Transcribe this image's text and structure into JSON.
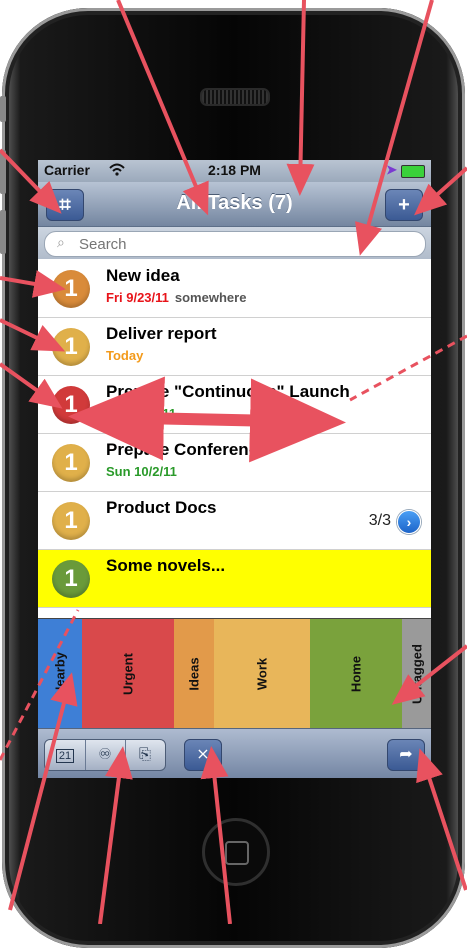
{
  "status_bar": {
    "carrier": "Carrier",
    "wifi_icon": "wifi-icon",
    "time": "2:18 PM",
    "location_icon": "location-arrow-icon",
    "battery_icon": "battery-icon"
  },
  "navbar": {
    "title": "All Tasks (7)",
    "left_icon": "gear-icon",
    "right_icon": "plus-icon",
    "right_label": "+"
  },
  "search": {
    "placeholder": "Search",
    "icon": "search-icon"
  },
  "tasks": [
    {
      "priority": "1",
      "name": "New idea",
      "date": "Fri 9/23/11",
      "date_color": "#e8141a",
      "location": "somewhere",
      "badge_color": "#d98b3a"
    },
    {
      "priority": "1",
      "name": "Deliver report",
      "date": "Today",
      "date_color": "#f39a1a",
      "location": "",
      "badge_color": "#e0b04a"
    },
    {
      "priority": "1",
      "name": "Prepare \"Continuous\" Launch",
      "date": "Thu 9/29/11",
      "date_color": "#2a9a2a",
      "location": "",
      "badge_color": "#d13a3a"
    },
    {
      "priority": "1",
      "name": "Prepare Conference",
      "date": "Sun 10/2/11",
      "date_color": "#2a9a2a",
      "location": "",
      "badge_color": "#e0b04a"
    },
    {
      "priority": "1",
      "name": "Product Docs",
      "date": "",
      "date_color": "#2a9a2a",
      "location": "",
      "badge_color": "#e0b04a",
      "count": "3/3",
      "disclosure_icon": "chevron-right-icon"
    },
    {
      "priority": "1",
      "name": "Some novels...",
      "date": "",
      "date_color": "#2a9a2a",
      "location": "",
      "badge_color": "#6a9a3a",
      "highlight": true
    }
  ],
  "categories": [
    {
      "label": "Nearby",
      "color": "#3e7fd6"
    },
    {
      "label": "Urgent",
      "color": "#d9494b"
    },
    {
      "label": "Ideas",
      "color": "#e29a4a"
    },
    {
      "label": "Work",
      "color": "#e8b65a"
    },
    {
      "label": "Home",
      "color": "#7aa23c"
    },
    {
      "label": "Untagged",
      "color": "#9a9a9a"
    }
  ],
  "toolbar": {
    "segment_icons": [
      "calendar-icon",
      "context-icon",
      "tag-icon"
    ],
    "calendar_day": "21",
    "center_icon": "filter-icon",
    "right_icon": "share-icon"
  },
  "colors": {
    "annotation_arrow": "#e8525f",
    "navbar": "#7486a0"
  }
}
